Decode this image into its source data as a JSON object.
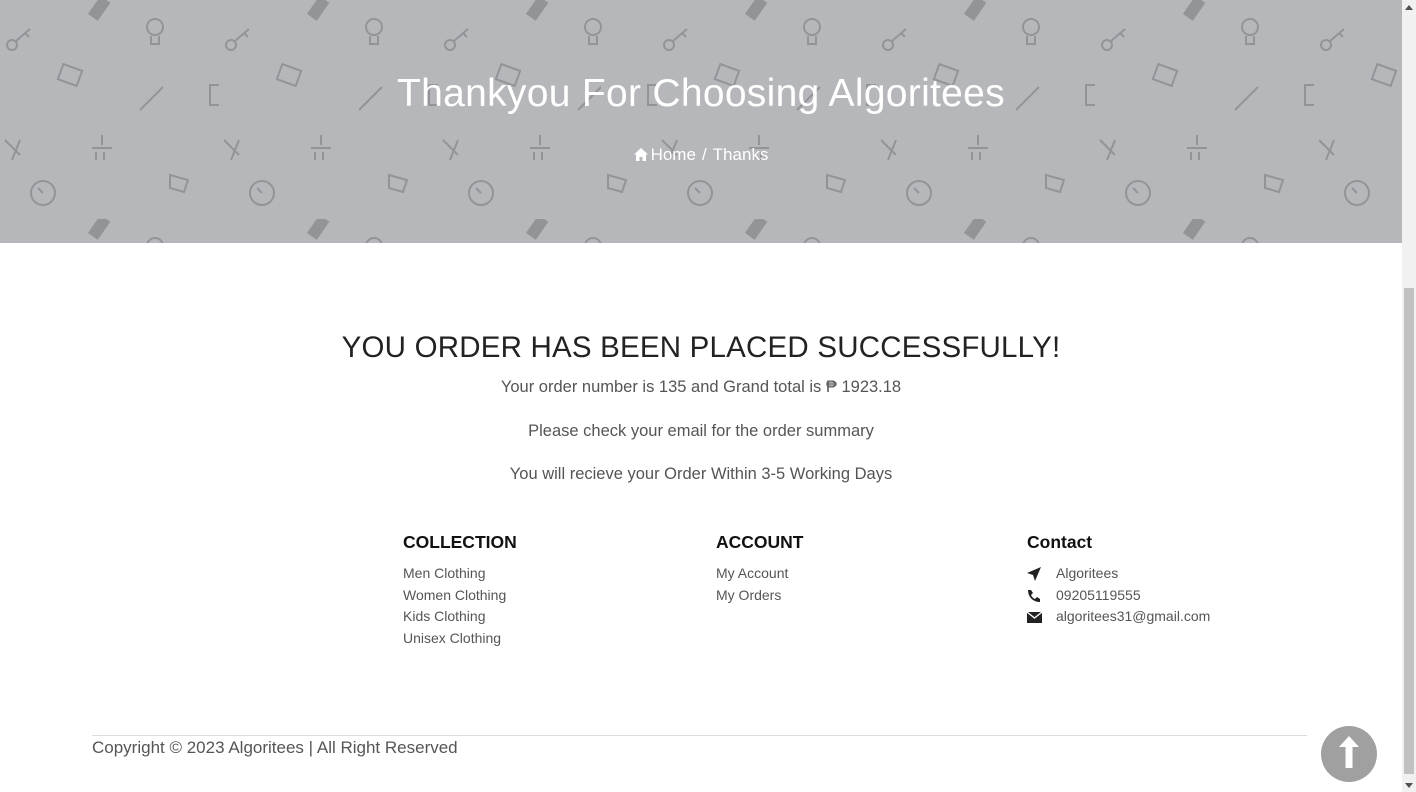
{
  "hero": {
    "title": "Thankyou For Choosing Algoritees",
    "breadcrumb": {
      "home": "Home",
      "separator": "/",
      "current": "Thanks"
    }
  },
  "main": {
    "headline": "YOU ORDER HAS BEEN PLACED SUCCESSFULLY!",
    "order_line": "Your order number is 135 and Grand total is ₱ 1923.18",
    "email_line": "Please check your email for the order summary",
    "delivery_line": "You will recieve your Order Within 3-5 Working Days"
  },
  "footer": {
    "collection": {
      "title": "COLLECTION",
      "links": [
        "Men Clothing",
        "Women Clothing",
        "Kids Clothing",
        "Unisex Clothing"
      ]
    },
    "account": {
      "title": "ACCOUNT",
      "links": [
        "My Account",
        "My Orders"
      ]
    },
    "contact": {
      "title": "Contact",
      "name": "Algoritees",
      "phone": "09205119555",
      "email": "algoritees31@gmail.com"
    },
    "copyright": "Copyright © 2023 Algoritees | All Right Reserved"
  },
  "icons": {
    "home": "home-icon",
    "location": "location-arrow-icon",
    "phone": "phone-icon",
    "email": "envelope-icon",
    "back_to_top": "arrow-up-icon"
  },
  "colors": {
    "hero_bg": "#b6b7bb",
    "back_to_top_bg": "#a0a0a0"
  }
}
